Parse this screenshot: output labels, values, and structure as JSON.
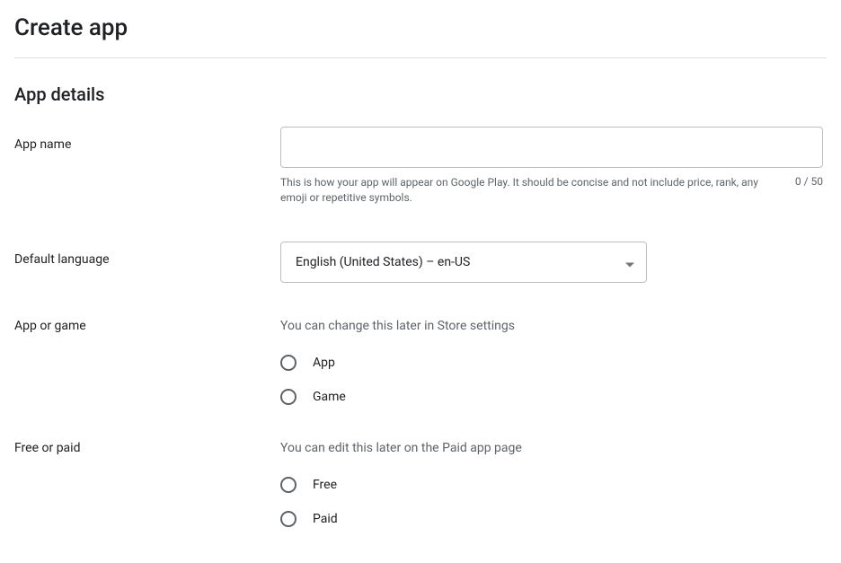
{
  "page": {
    "title": "Create app"
  },
  "section": {
    "title": "App details"
  },
  "appName": {
    "label": "App name",
    "value": "",
    "helper": "This is how your app will appear on Google Play. It should be concise and not include price, rank, any emoji or repetitive symbols.",
    "count": "0 / 50"
  },
  "defaultLanguage": {
    "label": "Default language",
    "selected": "English (United States) – en-US"
  },
  "appOrGame": {
    "label": "App or game",
    "info": "You can change this later in Store settings",
    "options": {
      "app": "App",
      "game": "Game"
    }
  },
  "freeOrPaid": {
    "label": "Free or paid",
    "info": "You can edit this later on the Paid app page",
    "options": {
      "free": "Free",
      "paid": "Paid"
    }
  }
}
